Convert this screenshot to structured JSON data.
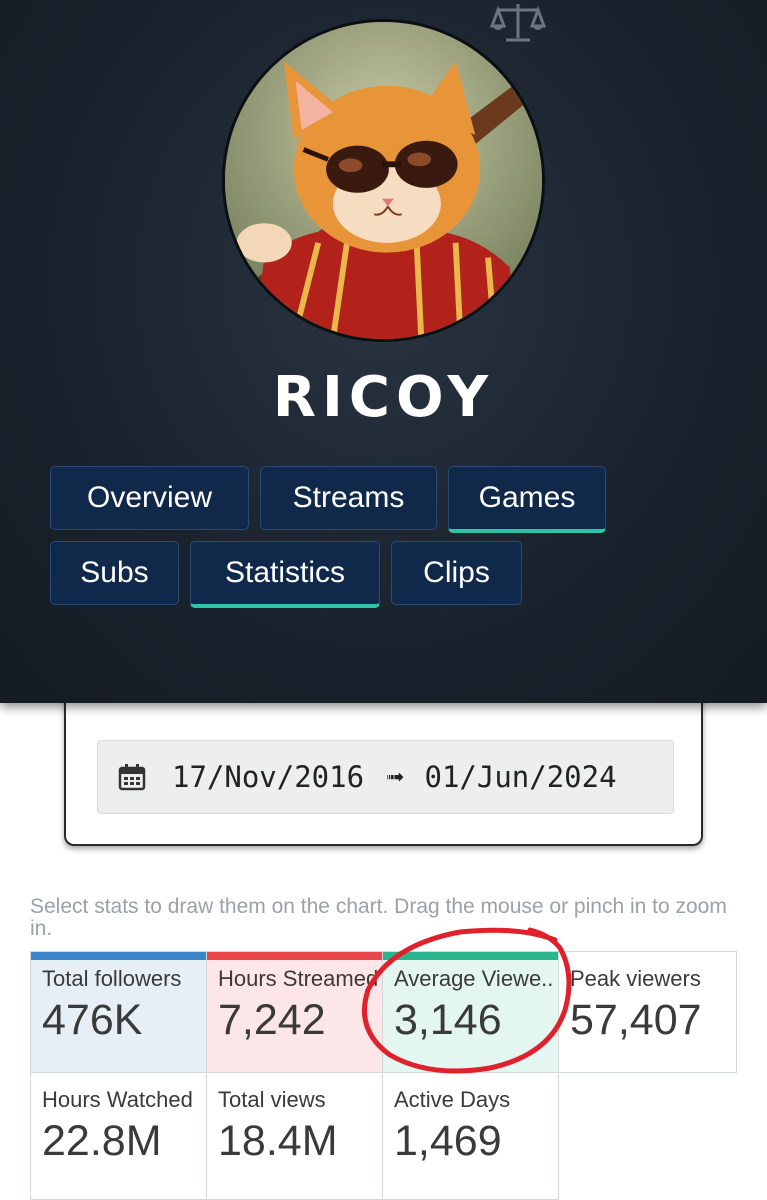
{
  "channel": {
    "name": "RICOY"
  },
  "tabs": [
    {
      "label": "Overview",
      "active": false
    },
    {
      "label": "Streams",
      "active": false
    },
    {
      "label": "Games",
      "active": true
    },
    {
      "label": "Subs",
      "active": false
    },
    {
      "label": "Statistics",
      "active": true
    },
    {
      "label": "Clips",
      "active": false
    }
  ],
  "date_range": {
    "from": "17/Nov/2016",
    "arrow": "➟",
    "to": "01/Jun/2024"
  },
  "hint": "Select stats to draw them on the chart. Drag the mouse or pinch in to zoom in.",
  "stats": [
    {
      "label": "Total followers",
      "value": "476K",
      "selected": true,
      "accent": "#3a86c8",
      "bg": "#e6eff6"
    },
    {
      "label": "Hours Streamed",
      "value": "7,242",
      "selected": true,
      "accent": "#e8454a",
      "bg": "#fde6e7"
    },
    {
      "label": "Average Viewe..",
      "value": "3,146",
      "selected": true,
      "accent": "#2bb58f",
      "bg": "#e3f6f0"
    },
    {
      "label": "Peak viewers",
      "value": "57,407",
      "selected": false
    },
    {
      "label": "Hours Watched",
      "value": "22.8M",
      "selected": false
    },
    {
      "label": "Total views",
      "value": "18.4M",
      "selected": false
    },
    {
      "label": "Active Days",
      "value": "1,469",
      "selected": false
    }
  ],
  "colors": {
    "header_bg": "#1a232e",
    "tab_bg": "#10294a",
    "tab_active_underline": "#2ec4a6",
    "annotation": "#e0202a"
  },
  "icons": {
    "top": "scale-icon",
    "calendar": "calendar-icon"
  }
}
